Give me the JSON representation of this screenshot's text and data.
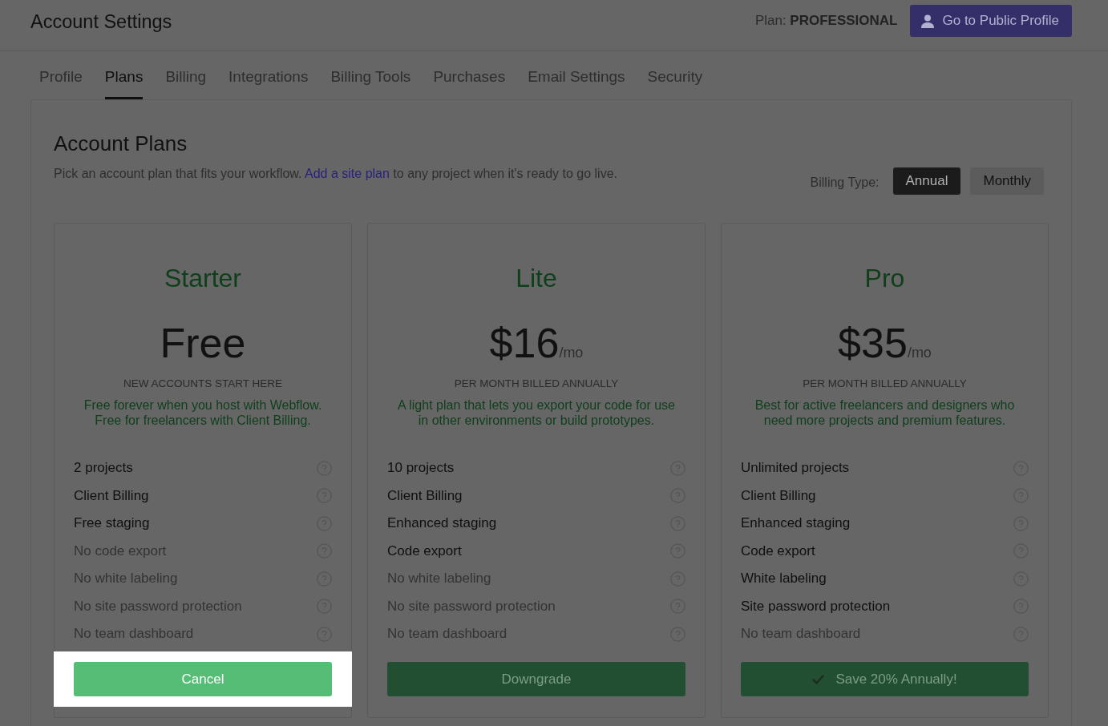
{
  "header": {
    "title": "Account Settings",
    "plan": "Plan: **PROFESSIONAL**",
    "profile_button": "Go to Public Profile"
  },
  "tabs": [
    {
      "label": "Profile",
      "selected": false
    },
    {
      "label": "Plans",
      "selected": true
    },
    {
      "label": "Billing",
      "selected": false
    },
    {
      "label": "Integrations",
      "selected": false
    },
    {
      "label": "Billing Tools",
      "selected": false
    },
    {
      "label": "Purchases",
      "selected": false
    },
    {
      "label": "Email Settings",
      "selected": false
    },
    {
      "label": "Security",
      "selected": false
    }
  ],
  "account_plans": {
    "title": "Account Plans",
    "description": {
      "before": "Pick an account plan that fits your workflow.",
      "link": "Add a site plan",
      "after": "to any project when it's ready to go live."
    },
    "billing": {
      "label": "Billing Type:",
      "options": [
        {
          "label": "Annual",
          "selected": true
        },
        {
          "label": "Monthly",
          "selected": false
        }
      ]
    },
    "plans": [
      {
        "name": "Starter",
        "price": "Free",
        "subtitle": "NEW ACCOUNTS START HERE",
        "description": "Free forever when you host with Webflow. Free for freelancers with Client Billing.",
        "features": [
          {
            "label": "2 projects",
            "included": true
          },
          {
            "label": "Client Billing",
            "included": true
          },
          {
            "label": "Free staging",
            "included": true
          },
          {
            "label": "No code export",
            "included": false
          },
          {
            "label": "No white labeling",
            "included": false
          },
          {
            "label": "No site password protection",
            "included": false
          },
          {
            "label": "No team dashboard",
            "included": false
          }
        ],
        "button": {
          "label": "Cancel",
          "kind": "plain",
          "highlighted": true
        }
      },
      {
        "name": "Lite",
        "price": "$16",
        "period": "/mo",
        "subtitle": "PER MONTH BILLED ANNUALLY",
        "description": "A light plan that lets you export your code for use in other environments or build prototypes.",
        "features": [
          {
            "label": "10 projects",
            "included": true
          },
          {
            "label": "Client Billing",
            "included": true
          },
          {
            "label": "Enhanced staging",
            "included": true
          },
          {
            "label": "Code export",
            "included": true
          },
          {
            "label": "No white labeling",
            "included": false
          },
          {
            "label": "No site password protection",
            "included": false
          },
          {
            "label": "No team dashboard",
            "included": false
          }
        ],
        "button": {
          "label": "Downgrade",
          "kind": "plain",
          "highlighted": false
        }
      },
      {
        "name": "Pro",
        "price": "$35",
        "period": "/mo",
        "subtitle": "PER MONTH BILLED ANNUALLY",
        "description": "Best for active freelancers and designers who need more projects and premium features.",
        "features": [
          {
            "label": "Unlimited projects",
            "included": true
          },
          {
            "label": "Client Billing",
            "included": true
          },
          {
            "label": "Enhanced staging",
            "included": true
          },
          {
            "label": "Code export",
            "included": true
          },
          {
            "label": "White labeling",
            "included": true
          },
          {
            "label": "Site password protection",
            "included": true
          },
          {
            "label": "No team dashboard",
            "included": false
          }
        ],
        "button": {
          "label": "Save 20% Annually!",
          "kind": "check",
          "highlighted": false
        }
      }
    ]
  }
}
